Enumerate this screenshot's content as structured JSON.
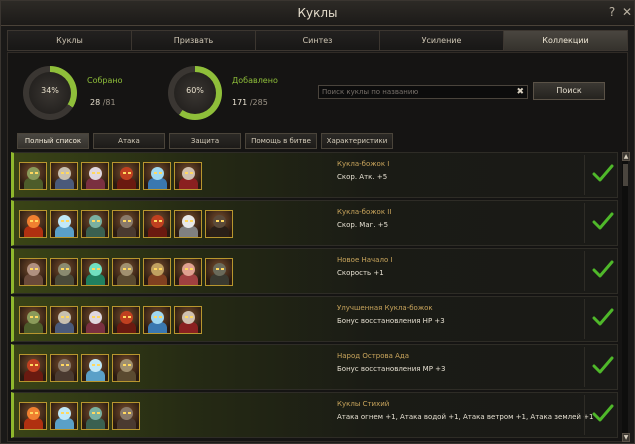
{
  "window": {
    "title": "Куклы",
    "help_label": "?",
    "close_label": "✕"
  },
  "tabs": [
    {
      "label": "Куклы",
      "active": false
    },
    {
      "label": "Призвать",
      "active": false
    },
    {
      "label": "Синтез",
      "active": false
    },
    {
      "label": "Усиление",
      "active": false
    },
    {
      "label": "Коллекции",
      "active": true
    }
  ],
  "stats": {
    "collected": {
      "percent_label": "34%",
      "percent": 34,
      "label": "Собрано",
      "count": "28",
      "total": "/81",
      "color": "#8fbf3a"
    },
    "added": {
      "percent_label": "60%",
      "percent": 60,
      "label": "Добавлено",
      "count": "171",
      "total": "/285",
      "color": "#8fbf3a"
    }
  },
  "search": {
    "placeholder": "Поиск куклы по названию",
    "value": "",
    "button_label": "Поиск"
  },
  "filters": [
    {
      "label": "Полный список",
      "active": true
    },
    {
      "label": "Атака",
      "active": false
    },
    {
      "label": "Защита",
      "active": false
    },
    {
      "label": "Помощь в битве",
      "active": false
    },
    {
      "label": "Характеристики",
      "active": false
    }
  ],
  "collections": [
    {
      "name": "Кукла-божок I",
      "bonus": "Скор. Атк. +5",
      "complete": true,
      "dolls": [
        "tree-doll",
        "tribal-doll",
        "imp-doll",
        "fire-demon-doll",
        "ice-doll",
        "warrior-doll"
      ]
    },
    {
      "name": "Кукла-божок II",
      "bonus": "Скор. Маг. +5",
      "complete": true,
      "dolls": [
        "flame-doll",
        "frost-doll",
        "goblin-doll",
        "golem-doll",
        "fire-demon-doll",
        "priest-doll",
        "shadow-doll"
      ]
    },
    {
      "name": "Новое Начало I",
      "bonus": "Скорость +1",
      "complete": true,
      "dolls": [
        "dwarf-doll",
        "orc-doll",
        "orb-doll",
        "knight-doll",
        "shaman-doll",
        "elf-doll",
        "ghost-doll"
      ]
    },
    {
      "name": "Улучшенная Кукла-божок",
      "bonus": "Бонус восстановления HP +3",
      "complete": true,
      "dolls": [
        "tree-doll",
        "tribal-doll",
        "imp-doll",
        "fire-demon-doll",
        "ice-doll",
        "warrior-doll"
      ]
    },
    {
      "name": "Народ Острова Ада",
      "bonus": "Бонус восстановления MP +3",
      "complete": true,
      "dolls": [
        "fire-demon-doll",
        "golem-doll",
        "frost-doll",
        "knight-doll"
      ]
    },
    {
      "name": "Куклы Стихий",
      "bonus": "Атака огнем +1, Атака водой +1, Атака ветром +1, Атака землей +1",
      "complete": true,
      "dolls": [
        "flame-doll",
        "frost-doll",
        "goblin-doll",
        "golem-doll"
      ]
    }
  ],
  "colors": {
    "accent_green": "#8fbf3a",
    "check_green": "#4fb82a",
    "gold_border": "#b8962e",
    "set_name": "#c9a55c"
  }
}
